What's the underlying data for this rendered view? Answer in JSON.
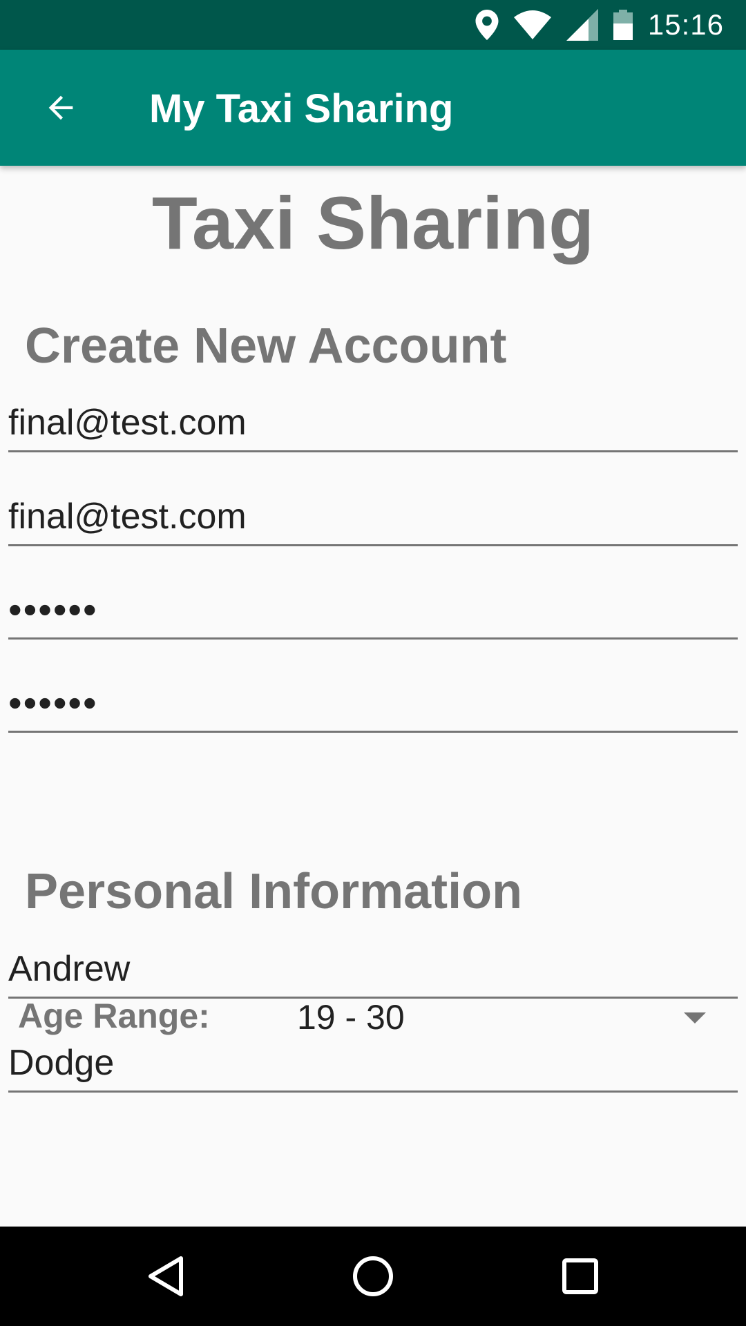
{
  "status_bar": {
    "time": "15:16",
    "icons": [
      "location-icon",
      "wifi-icon",
      "signal-icon",
      "battery-icon"
    ]
  },
  "app_bar": {
    "title": "My Taxi Sharing",
    "back_icon": "arrow-left-icon"
  },
  "page": {
    "heading": "Taxi Sharing",
    "account_section": {
      "title": "Create New Account",
      "email": "final@test.com",
      "confirm_email": "final@test.com",
      "password": "••••••",
      "confirm_password": "••••••"
    },
    "personal_section": {
      "title": "Personal Information",
      "first_name": "Andrew",
      "last_name": "Dodge",
      "age_label": "Age Range:",
      "age_value": "19 - 30"
    }
  },
  "nav_bar": {
    "icons": [
      "back-triangle-icon",
      "home-circle-icon",
      "recents-square-icon"
    ]
  },
  "colors": {
    "primary": "#008577",
    "primary_dark": "#00574b",
    "text_grey": "#757575"
  }
}
